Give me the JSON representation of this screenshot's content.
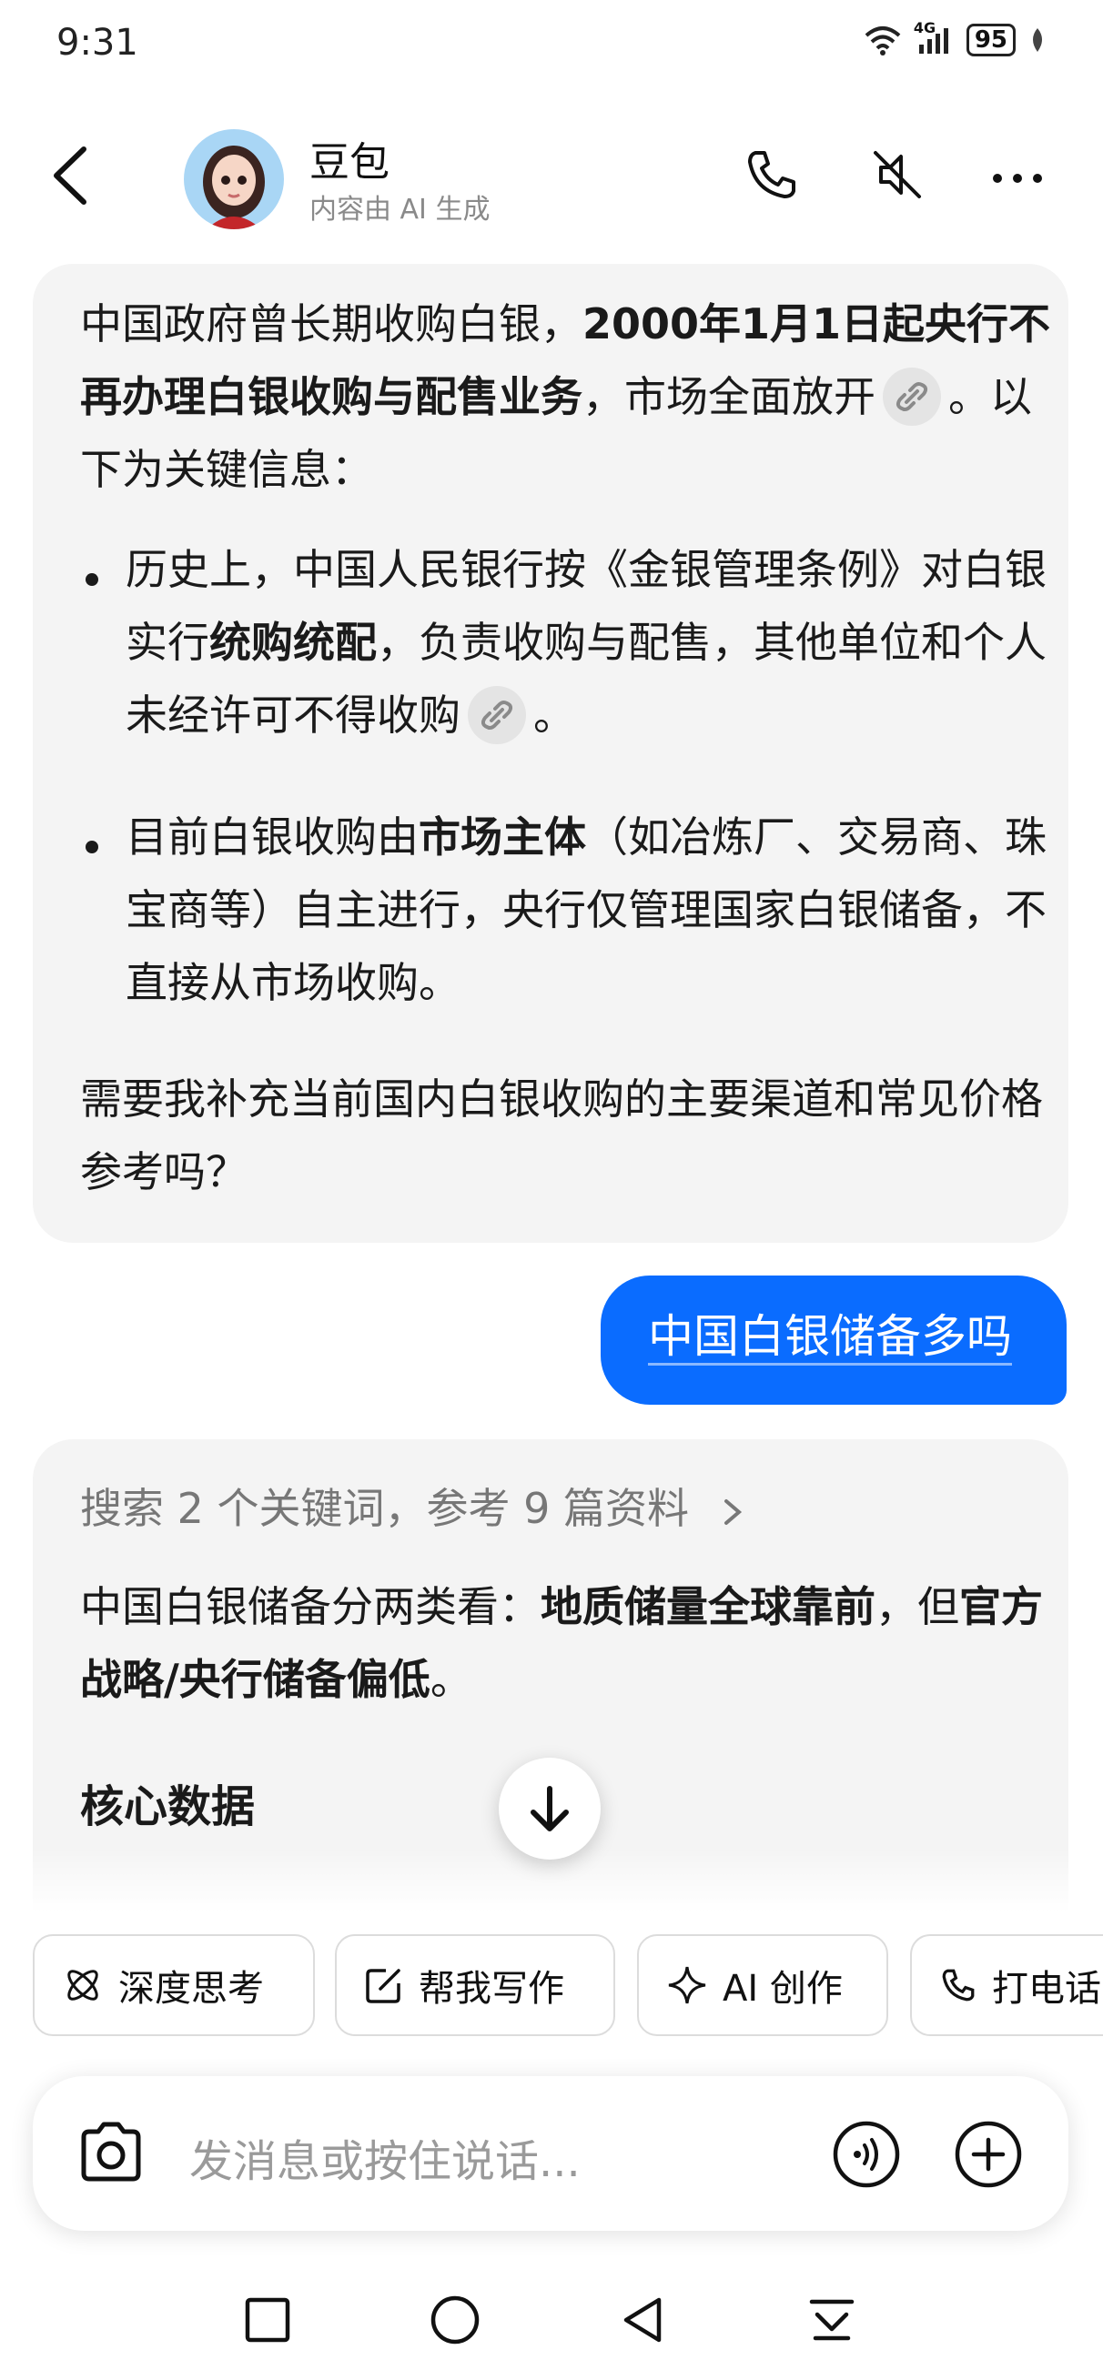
{
  "status": {
    "time": "9:31",
    "network": "4G",
    "battery": "95"
  },
  "header": {
    "title": "豆包",
    "subtitle": "内容由 AI 生成",
    "icons": [
      "back-arrow-icon",
      "phone-icon",
      "mute-icon",
      "more-icon"
    ]
  },
  "messages": {
    "ai1": {
      "p1_a": "中国政府曾长期收购白银，",
      "p1_b": "2000年1月1日起央行不再办理白银收购与配售业务",
      "p1_c": "，市场全面放开",
      "p1_d": "。以下为关键信息：",
      "b1_a": "历史上，中国人民银行按《金银管理条例》对白银实行",
      "b1_b": "统购统配",
      "b1_c": "，负责收购与配售，其他单位和个人未经许可不得收购",
      "b1_d": "。",
      "b2_a": "目前白银收购由",
      "b2_b": "市场主体",
      "b2_c": "（如冶炼厂、交易商、珠宝商等）自主进行，央行仅管理国家白银储备，不直接从市场收购。",
      "p2": "需要我补充当前国内白银收购的主要渠道和常见价格参考吗？"
    },
    "user1": "中国白银储备多吗",
    "ai2": {
      "search": "搜索 2 个关键词，参考 9 篇资料",
      "p1_a": "中国白银储备分两类看：",
      "p1_b": "地质储量全球靠前",
      "p1_c": "，但",
      "p1_d": "官方战略/央行储备偏低",
      "p1_e": "。",
      "h1": "核心数据"
    }
  },
  "chips": [
    "深度思考",
    "帮我写作",
    "AI 创作",
    "打电话"
  ],
  "input": {
    "placeholder": "发消息或按住说话..."
  },
  "nav": [
    "recent-apps-icon",
    "home-icon",
    "back-icon",
    "notification-pulldown-icon"
  ],
  "colors": {
    "accent": "#0a6cff",
    "bubble": "#f4f4f4"
  }
}
